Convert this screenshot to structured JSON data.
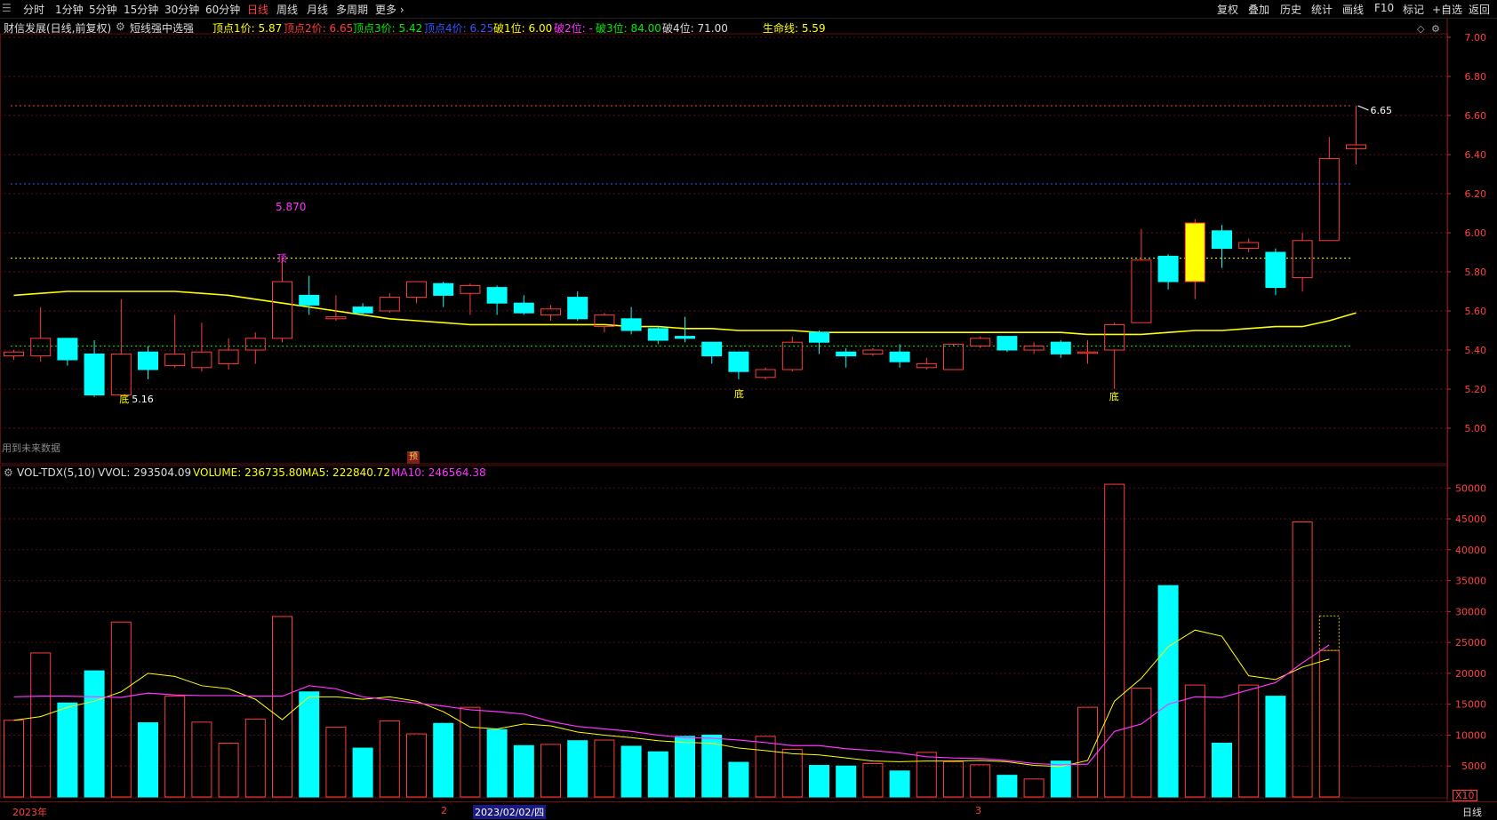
{
  "toolbar": {
    "periods": [
      "分时",
      "1分钟",
      "5分钟",
      "15分钟",
      "30分钟",
      "60分钟",
      "日线",
      "周线",
      "月线",
      "多周期",
      "更多 ›"
    ],
    "active_period": "日线",
    "right_buttons": [
      "复权",
      "叠加",
      "历史",
      "统计",
      "画线",
      "F10",
      "标记",
      "+自选",
      "返回"
    ]
  },
  "info": {
    "title": "财信发展(日线,前复权)",
    "indicator": "短线强中选强",
    "top1": "顶点1价: 5.87",
    "top2": "顶点2价: 6.65",
    "top3": "顶点3价: 5.42",
    "top4": "顶点4价: 6.25",
    "break1": "破1位: 6.00",
    "break2": "破2位: -",
    "break3": "破3位: 84.00",
    "break4": "破4位: 71.00",
    "life": "生命线: 5.59"
  },
  "volinfo": {
    "name": "VOL-TDX(5,10)",
    "vvol": "VVOL: 293504.09",
    "volume": "VOLUME: 236735.80",
    "ma5": "MA5: 222840.72",
    "ma10": "MA10: 246564.38"
  },
  "notes": {
    "future": "用到未来数据",
    "yu": "预",
    "ding": "顶",
    "di": "底",
    "di_value": "5.16",
    "peak_label": "5.870",
    "last_price": "6.65"
  },
  "bottom": {
    "year": "2023年",
    "m2": "2",
    "date": "2023/02/02/四",
    "m3": "3",
    "x10": "X10",
    "period": "日线"
  },
  "colors": {
    "up": "#ff3c3c",
    "down": "#00ffff",
    "yellow": "#ffff00",
    "magenta": "#ff33ff",
    "grid": "#5a0f0f"
  },
  "chart_data": {
    "type": "candlestick",
    "price_axis": [
      5.0,
      5.2,
      5.4,
      5.6,
      5.8,
      6.0,
      6.2,
      6.4,
      6.6,
      6.8,
      7.0
    ],
    "volume_axis": [
      5000,
      10000,
      15000,
      20000,
      25000,
      30000,
      35000,
      40000,
      45000,
      50000
    ],
    "ref_lines": {
      "red": 6.65,
      "blue": 6.25,
      "yellow": 5.87,
      "green": 5.42
    },
    "candles": [
      {
        "o": 5.37,
        "h": 5.4,
        "l": 5.35,
        "c": 5.39
      },
      {
        "o": 5.37,
        "h": 5.62,
        "l": 5.34,
        "c": 5.46
      },
      {
        "o": 5.46,
        "h": 5.46,
        "l": 5.32,
        "c": 5.35
      },
      {
        "o": 5.38,
        "h": 5.45,
        "l": 5.16,
        "c": 5.17
      },
      {
        "o": 5.17,
        "h": 5.66,
        "l": 5.16,
        "c": 5.38
      },
      {
        "o": 5.39,
        "h": 5.42,
        "l": 5.25,
        "c": 5.3
      },
      {
        "o": 5.32,
        "h": 5.58,
        "l": 5.31,
        "c": 5.38
      },
      {
        "o": 5.31,
        "h": 5.54,
        "l": 5.29,
        "c": 5.39
      },
      {
        "o": 5.33,
        "h": 5.46,
        "l": 5.3,
        "c": 5.4
      },
      {
        "o": 5.4,
        "h": 5.49,
        "l": 5.33,
        "c": 5.46
      },
      {
        "o": 5.46,
        "h": 5.87,
        "l": 5.44,
        "c": 5.75
      },
      {
        "o": 5.68,
        "h": 5.78,
        "l": 5.58,
        "c": 5.63
      },
      {
        "o": 5.56,
        "h": 5.68,
        "l": 5.55,
        "c": 5.57
      },
      {
        "o": 5.62,
        "h": 5.64,
        "l": 5.58,
        "c": 5.59
      },
      {
        "o": 5.6,
        "h": 5.69,
        "l": 5.59,
        "c": 5.67
      },
      {
        "o": 5.67,
        "h": 5.75,
        "l": 5.64,
        "c": 5.75
      },
      {
        "o": 5.74,
        "h": 5.75,
        "l": 5.62,
        "c": 5.68
      },
      {
        "o": 5.69,
        "h": 5.74,
        "l": 5.58,
        "c": 5.73
      },
      {
        "o": 5.72,
        "h": 5.73,
        "l": 5.58,
        "c": 5.64
      },
      {
        "o": 5.64,
        "h": 5.68,
        "l": 5.58,
        "c": 5.59
      },
      {
        "o": 5.58,
        "h": 5.63,
        "l": 5.55,
        "c": 5.61
      },
      {
        "o": 5.67,
        "h": 5.7,
        "l": 5.55,
        "c": 5.56
      },
      {
        "o": 5.52,
        "h": 5.59,
        "l": 5.49,
        "c": 5.58
      },
      {
        "o": 5.56,
        "h": 5.62,
        "l": 5.48,
        "c": 5.5
      },
      {
        "o": 5.51,
        "h": 5.52,
        "l": 5.43,
        "c": 5.45
      },
      {
        "o": 5.47,
        "h": 5.57,
        "l": 5.44,
        "c": 5.46
      },
      {
        "o": 5.44,
        "h": 5.44,
        "l": 5.33,
        "c": 5.37
      },
      {
        "o": 5.39,
        "h": 5.39,
        "l": 5.25,
        "c": 5.29
      },
      {
        "o": 5.26,
        "h": 5.31,
        "l": 5.25,
        "c": 5.3
      },
      {
        "o": 5.3,
        "h": 5.47,
        "l": 5.29,
        "c": 5.44
      },
      {
        "o": 5.49,
        "h": 5.5,
        "l": 5.38,
        "c": 5.44
      },
      {
        "o": 5.39,
        "h": 5.41,
        "l": 5.31,
        "c": 5.37
      },
      {
        "o": 5.38,
        "h": 5.41,
        "l": 5.37,
        "c": 5.4
      },
      {
        "o": 5.39,
        "h": 5.43,
        "l": 5.31,
        "c": 5.34
      },
      {
        "o": 5.31,
        "h": 5.36,
        "l": 5.3,
        "c": 5.33
      },
      {
        "o": 5.3,
        "h": 5.42,
        "l": 5.3,
        "c": 5.43
      },
      {
        "o": 5.42,
        "h": 5.47,
        "l": 5.41,
        "c": 5.46
      },
      {
        "o": 5.47,
        "h": 5.47,
        "l": 5.39,
        "c": 5.4
      },
      {
        "o": 5.4,
        "h": 5.44,
        "l": 5.38,
        "c": 5.42
      },
      {
        "o": 5.44,
        "h": 5.45,
        "l": 5.36,
        "c": 5.38
      },
      {
        "o": 5.39,
        "h": 5.45,
        "l": 5.33,
        "c": 5.39
      },
      {
        "o": 5.4,
        "h": 5.54,
        "l": 5.2,
        "c": 5.53
      },
      {
        "o": 5.54,
        "h": 6.02,
        "l": 5.54,
        "c": 5.86
      },
      {
        "o": 5.88,
        "h": 5.89,
        "l": 5.71,
        "c": 5.75
      },
      {
        "o": 5.75,
        "h": 6.07,
        "l": 5.66,
        "c": 6.05
      },
      {
        "o": 6.01,
        "h": 6.04,
        "l": 5.82,
        "c": 5.92
      },
      {
        "o": 5.92,
        "h": 5.97,
        "l": 5.9,
        "c": 5.95
      },
      {
        "o": 5.9,
        "h": 5.92,
        "l": 5.68,
        "c": 5.72
      },
      {
        "o": 5.77,
        "h": 6.0,
        "l": 5.7,
        "c": 5.96
      },
      {
        "o": 5.96,
        "h": 6.49,
        "l": 5.96,
        "c": 6.38
      },
      {
        "o": 6.43,
        "h": 6.65,
        "l": 6.35,
        "c": 6.45
      }
    ],
    "life_line": [
      5.68,
      5.69,
      5.7,
      5.7,
      5.7,
      5.7,
      5.7,
      5.69,
      5.68,
      5.66,
      5.64,
      5.62,
      5.6,
      5.58,
      5.56,
      5.55,
      5.54,
      5.53,
      5.53,
      5.53,
      5.53,
      5.53,
      5.53,
      5.52,
      5.52,
      5.51,
      5.51,
      5.5,
      5.5,
      5.5,
      5.49,
      5.49,
      5.49,
      5.49,
      5.49,
      5.49,
      5.49,
      5.49,
      5.49,
      5.49,
      5.48,
      5.48,
      5.48,
      5.49,
      5.5,
      5.5,
      5.51,
      5.52,
      5.52,
      5.55,
      5.59
    ],
    "volume": [
      12400,
      23300,
      15200,
      20400,
      28300,
      12000,
      16300,
      12100,
      8700,
      12600,
      29200,
      17000,
      11300,
      7900,
      12300,
      10200,
      11900,
      14500,
      10900,
      8300,
      8500,
      9100,
      9200,
      8200,
      7300,
      9800,
      10000,
      5600,
      9800,
      7700,
      5100,
      5000,
      5400,
      4200,
      7200,
      5700,
      5200,
      3500,
      2900,
      5800,
      14500,
      50600,
      17600,
      34200,
      18100,
      8700,
      18100,
      16300,
      44500,
      23700
    ],
    "volume_ghost": 29300,
    "ma5": [
      12400,
      13000,
      14500,
      15500,
      17000,
      20000,
      19500,
      18000,
      17500,
      15800,
      12500,
      16200,
      16200,
      15800,
      16200,
      15500,
      13800,
      11300,
      11000,
      11800,
      11500,
      10500,
      10000,
      9600,
      9100,
      8800,
      8700,
      7900,
      7500,
      7000,
      6800,
      6300,
      5800,
      5700,
      5800,
      5800,
      5900,
      5700,
      5100,
      4900,
      5900,
      15500,
      19200,
      24300,
      27000,
      26000,
      19600,
      19000,
      21000,
      22300
    ],
    "ma10": [
      16200,
      16300,
      16300,
      16200,
      16100,
      16800,
      16500,
      16400,
      16400,
      16300,
      16300,
      18000,
      17500,
      16200,
      15700,
      15200,
      14700,
      14100,
      13800,
      13400,
      12200,
      11400,
      11000,
      10600,
      10000,
      9600,
      9500,
      9200,
      8800,
      8300,
      8300,
      7800,
      7500,
      7100,
      6500,
      6300,
      6200,
      5900,
      5400,
      5200,
      5300,
      10600,
      11800,
      15000,
      16200,
      16100,
      17300,
      18500,
      21700,
      24600
    ]
  }
}
